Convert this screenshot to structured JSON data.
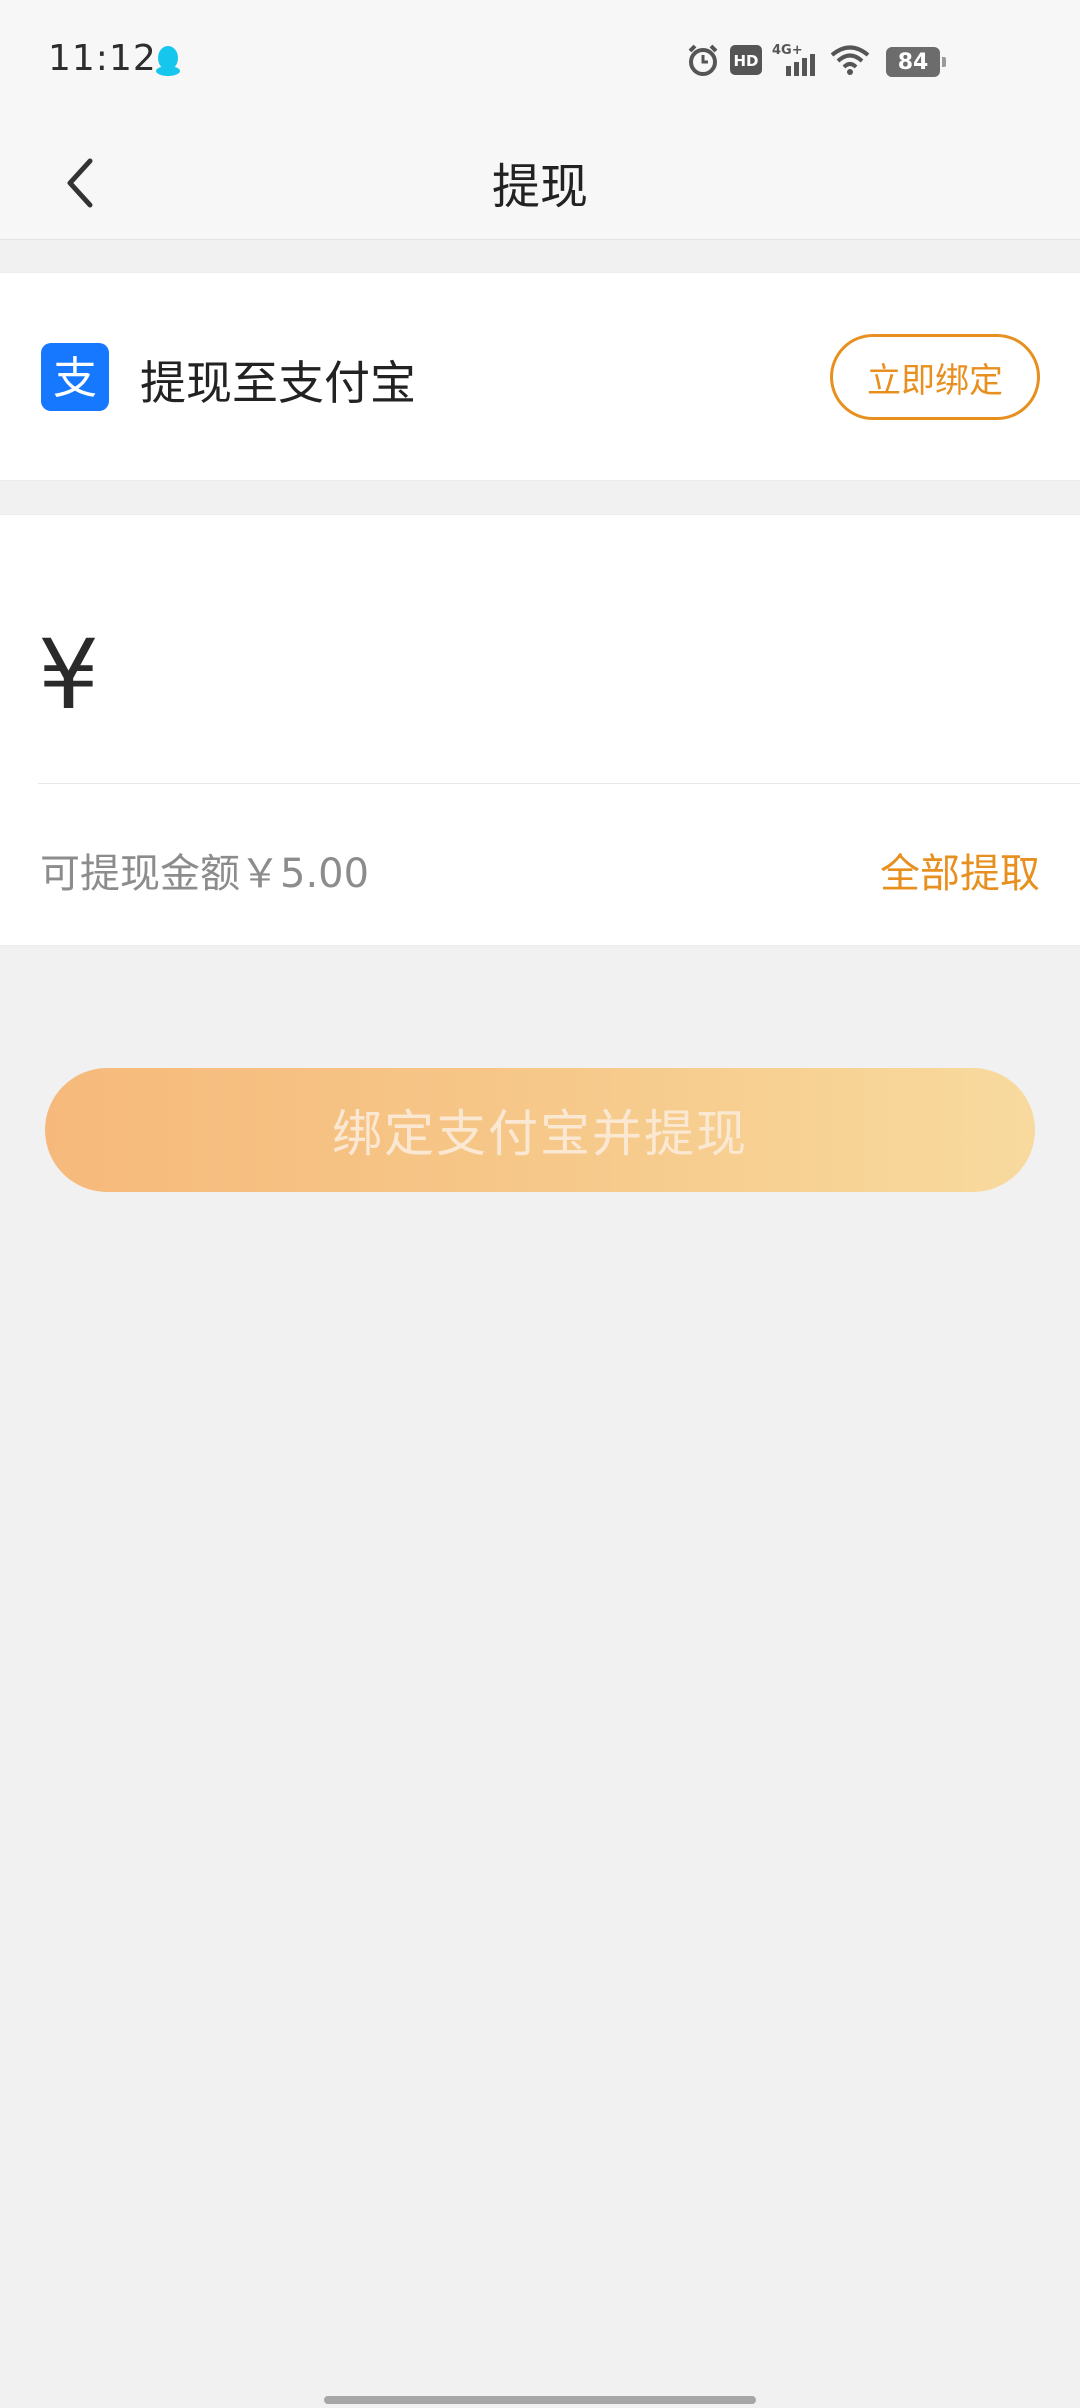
{
  "status_bar": {
    "time": "11:12",
    "network": "4G+",
    "hd": "HD",
    "battery": "84",
    "icons": [
      "qq-icon",
      "alarm-icon",
      "hd-icon",
      "signal-icon",
      "wifi-icon",
      "battery-icon"
    ]
  },
  "nav": {
    "title": "提现",
    "back_icon": "chevron-left-icon"
  },
  "alipay": {
    "label": "提现至支付宝",
    "bind_button": "立即绑定",
    "logo_glyph": "支",
    "brand_color": "#1677ff"
  },
  "amount": {
    "currency_symbol": "¥",
    "input_value": "",
    "available_label": "可提现金额￥5.00",
    "withdraw_all": "全部提取"
  },
  "submit": {
    "label": "绑定支付宝并提现"
  },
  "colors": {
    "accent": "#e8901f",
    "background": "#f1f1f1"
  }
}
